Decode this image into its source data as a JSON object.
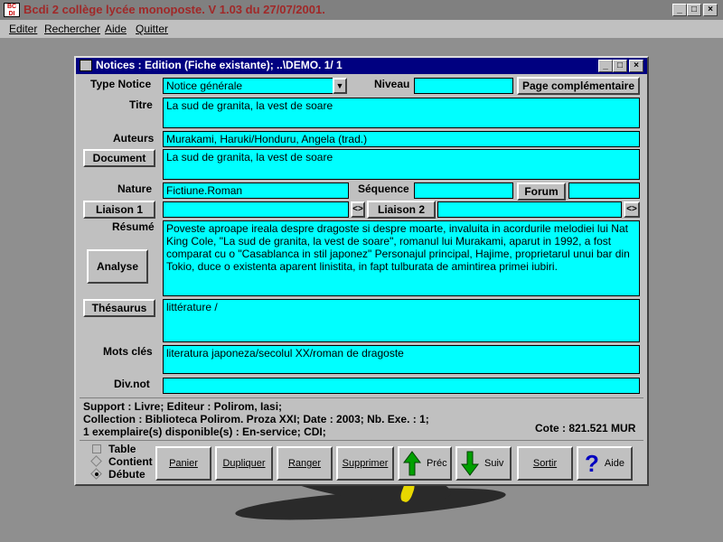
{
  "window": {
    "title": "Bcdi 2 collège lycée monoposte. V 1.03 du 27/07/2001."
  },
  "menu": [
    "Editer",
    "Rechercher",
    "Aide",
    "Quitter"
  ],
  "dialog": {
    "title": "Notices : Edition (Fiche existante); ..\\DEMO. 1/ 1"
  },
  "form": {
    "type_notice_label": "Type Notice",
    "type_notice_value": "Notice générale",
    "niveau_label": "Niveau",
    "page_comp_label": "Page complémentaire",
    "titre_label": "Titre",
    "titre_value": "La sud de granita, la vest de soare",
    "auteurs_label": "Auteurs",
    "auteurs_value": "Murakami, Haruki/Honduru, Angela (trad.)",
    "document_label": "Document",
    "document_value": "La sud de granita, la vest de soare",
    "nature_label": "Nature",
    "nature_value": "Fictiune.Roman",
    "sequence_label": "Séquence",
    "forum_label": "Forum",
    "liaison1_label": "Liaison 1",
    "liaison2_label": "Liaison 2",
    "link_symbol": "<>",
    "resume_label": "Résumé",
    "resume_value": "Poveste aproape ireala despre dragoste si despre moarte, invaluita in acordurile melodiei lui Nat King Cole, \"La sud de granita, la vest de soare\", romanul lui Murakami, aparut in 1992, a fost comparat cu o \"Casablanca in stil japonez\" Personajul principal, Hajime, proprietarul unui bar din Tokio, duce o existenta aparent linistita, in fapt tulburata de amintirea primei iubiri.",
    "analyse_label": "Analyse",
    "thesaurus_label": "Thésaurus",
    "thesaurus_value": "littérature /",
    "mots_cles_label": "Mots clés",
    "mots_cles_value": "literatura japoneza/secolul XX/roman de dragoste",
    "divnot_label": "Div.not"
  },
  "info": {
    "line1": "Support : Livre;  Editeur : Polirom, Iasi;",
    "line2": "Collection : Biblioteca Polirom. Proza XXI;  Date : 2003;  Nb. Exe. : 1;",
    "line3": "1 exemplaire(s) disponible(s)  :  En-service; CDI;",
    "cote": "Cote : 821.521 MUR"
  },
  "options": [
    "Table",
    "Contient",
    "Débute"
  ],
  "toolbar": {
    "panier": "Panier",
    "dupliquer": "Dupliquer",
    "ranger": "Ranger",
    "supprimer": "Supprimer",
    "prec": "Préc",
    "suiv": "Suiv",
    "sortir": "Sortir",
    "aide": "Aide"
  },
  "colors": {
    "field": "#00ffff",
    "dialog_title": "#000080",
    "window_face": "#c0c0c0"
  }
}
